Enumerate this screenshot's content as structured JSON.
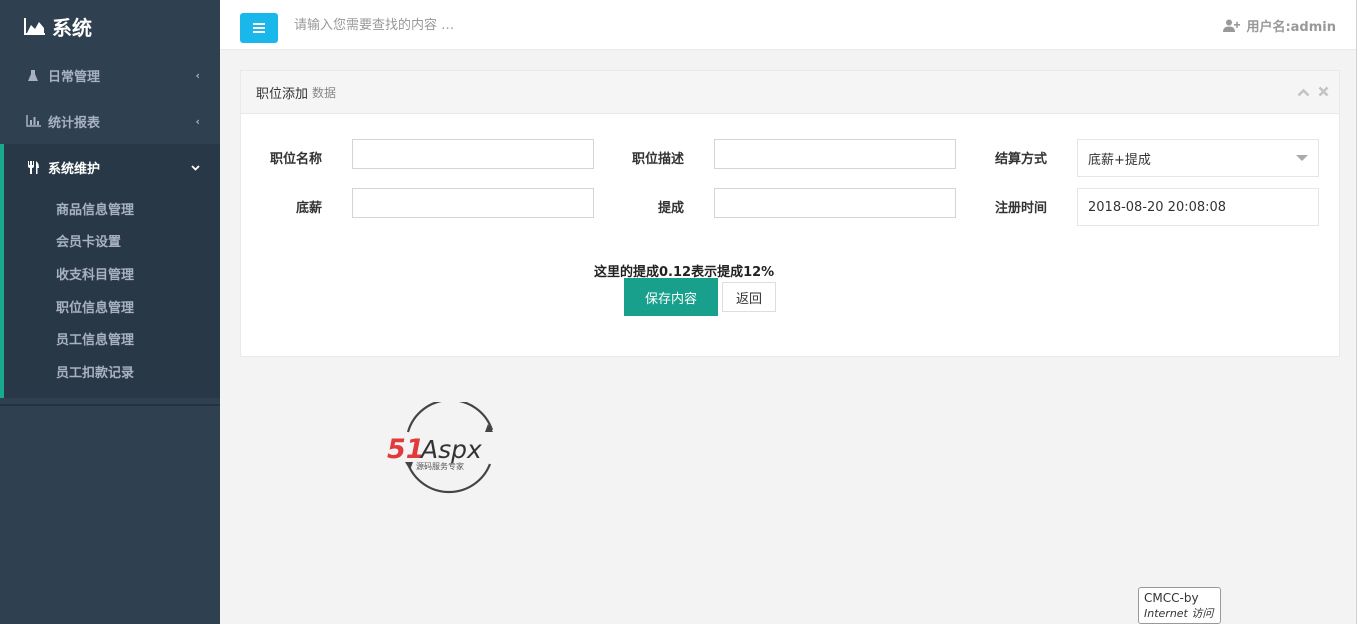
{
  "sidebar": {
    "brand": "系统",
    "items": [
      {
        "label": "日常管理"
      },
      {
        "label": "统计报表"
      },
      {
        "label": "系统维护"
      }
    ],
    "submenu": [
      {
        "label": "商品信息管理"
      },
      {
        "label": "会员卡设置"
      },
      {
        "label": "收支科目管理"
      },
      {
        "label": "职位信息管理"
      },
      {
        "label": "员工信息管理"
      },
      {
        "label": "员工扣款记录"
      }
    ]
  },
  "topbar": {
    "search_placeholder": "请输入您需要查找的内容 …",
    "user": "用户名:admin"
  },
  "panel": {
    "title": "职位添加",
    "subtitle": "数据",
    "fields": {
      "name_label": "职位名称",
      "desc_label": "职位描述",
      "settle_label": "结算方式",
      "settle_value": "底薪+提成",
      "base_label": "底薪",
      "commission_label": "提成",
      "regtime_label": "注册时间",
      "regtime_value": "2018-08-20 20:08:08"
    },
    "hint": "这里的提成0.12表示提成12%",
    "save_label": "保存内容",
    "back_label": "返回"
  },
  "logo": {
    "text_a": "51",
    "text_b": "Aspx",
    "tagline": "源码服务专家"
  },
  "badge": {
    "line1": "CMCC-by",
    "line2": "Internet 访问"
  },
  "colors": {
    "sidebar": "#2f4050",
    "accent": "#18a08c",
    "menu_button": "#1ab7ea"
  }
}
